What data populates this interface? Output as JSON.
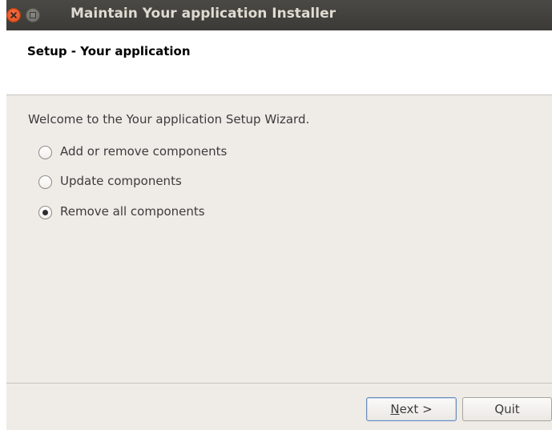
{
  "window": {
    "title": "Maintain Your application Installer"
  },
  "header": {
    "title": "Setup - Your application"
  },
  "main": {
    "welcome_text": "Welcome to the Your application Setup Wizard.",
    "options": [
      {
        "label": "Add or remove components",
        "checked": false
      },
      {
        "label": "Update components",
        "checked": false
      },
      {
        "label": "Remove all components",
        "checked": true
      }
    ]
  },
  "footer": {
    "next_label_mnemonic": "N",
    "next_label_rest": "ext >",
    "quit_label": "Quit"
  },
  "colors": {
    "titlebar": "#3c3b37",
    "window_bg": "#efebe7",
    "close_button": "#e9561e"
  },
  "icons": {
    "close": "close-icon",
    "maximize": "maximize-icon"
  }
}
